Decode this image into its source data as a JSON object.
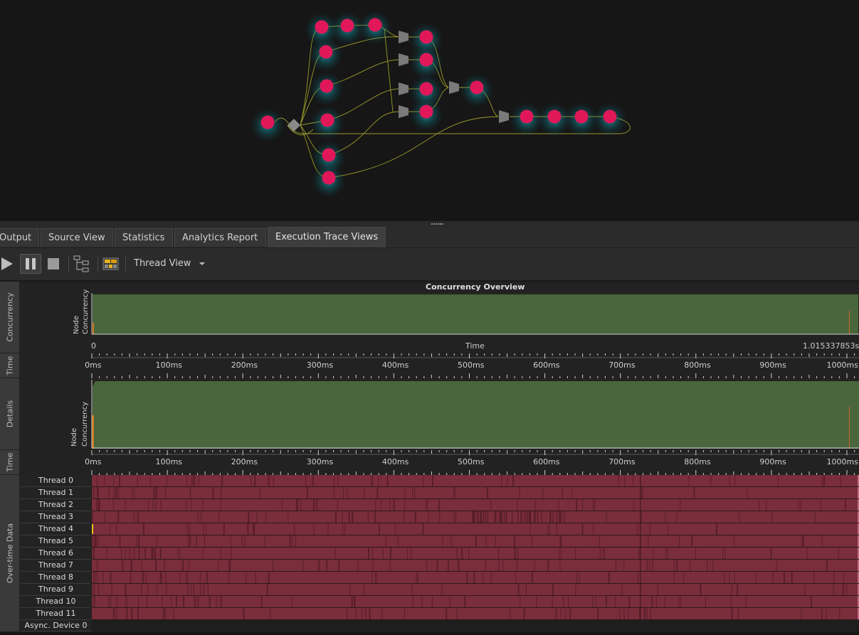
{
  "tabs": [
    {
      "label": "Output"
    },
    {
      "label": "Source View"
    },
    {
      "label": "Statistics"
    },
    {
      "label": "Analytics Report"
    },
    {
      "label": "Execution Trace Views"
    }
  ],
  "toolbar": {
    "play_icon": "play-icon",
    "pause_icon": "pause-icon",
    "stop_icon": "stop-icon",
    "tree_icon": "tree-layout-icon",
    "color_icon": "color-palette-icon",
    "view_select": "Thread View"
  },
  "panels": {
    "concurrency": {
      "side_label": "Concurrency",
      "title": "Concurrency Overview",
      "ylabel_1": "Node",
      "ylabel_2": "Concurrency",
      "xlabel": "Time",
      "x_start": "0",
      "x_end": "1.015337853s"
    },
    "time": {
      "side_label": "Time"
    },
    "details": {
      "side_label": "Details",
      "ylabel_1": "Node",
      "ylabel_2": "Concurrency"
    },
    "time2": {
      "side_label": "Time"
    },
    "overtime": {
      "side_label": "Over-time Data"
    }
  },
  "time_ticks": [
    "0ms",
    "100ms",
    "200ms",
    "300ms",
    "400ms",
    "500ms",
    "600ms",
    "700ms",
    "800ms",
    "900ms",
    "1000ms"
  ],
  "threads": [
    "Thread 0",
    "Thread 1",
    "Thread 2",
    "Thread 3",
    "Thread 4",
    "Thread 5",
    "Thread 6",
    "Thread 7",
    "Thread 8",
    "Thread 9",
    "Thread 10",
    "Thread 11",
    "Async. Device 0"
  ],
  "colors": {
    "node": "#e0185a",
    "node_glow": "#12b7c8",
    "edge": "#9a9a2a",
    "concurrency_fill": "#4a663c",
    "thread_bar": "#7a2d3b",
    "thread_mark": "#5a1f2a"
  },
  "chart_data": {
    "type": "area",
    "title": "Concurrency Overview",
    "xlabel": "Time",
    "ylabel": "Node Concurrency",
    "xlim": [
      "0",
      "1.015337853s"
    ],
    "x_ticks": [
      "0ms",
      "100ms",
      "200ms",
      "300ms",
      "400ms",
      "500ms",
      "600ms",
      "700ms",
      "800ms",
      "900ms",
      "1000ms"
    ]
  }
}
